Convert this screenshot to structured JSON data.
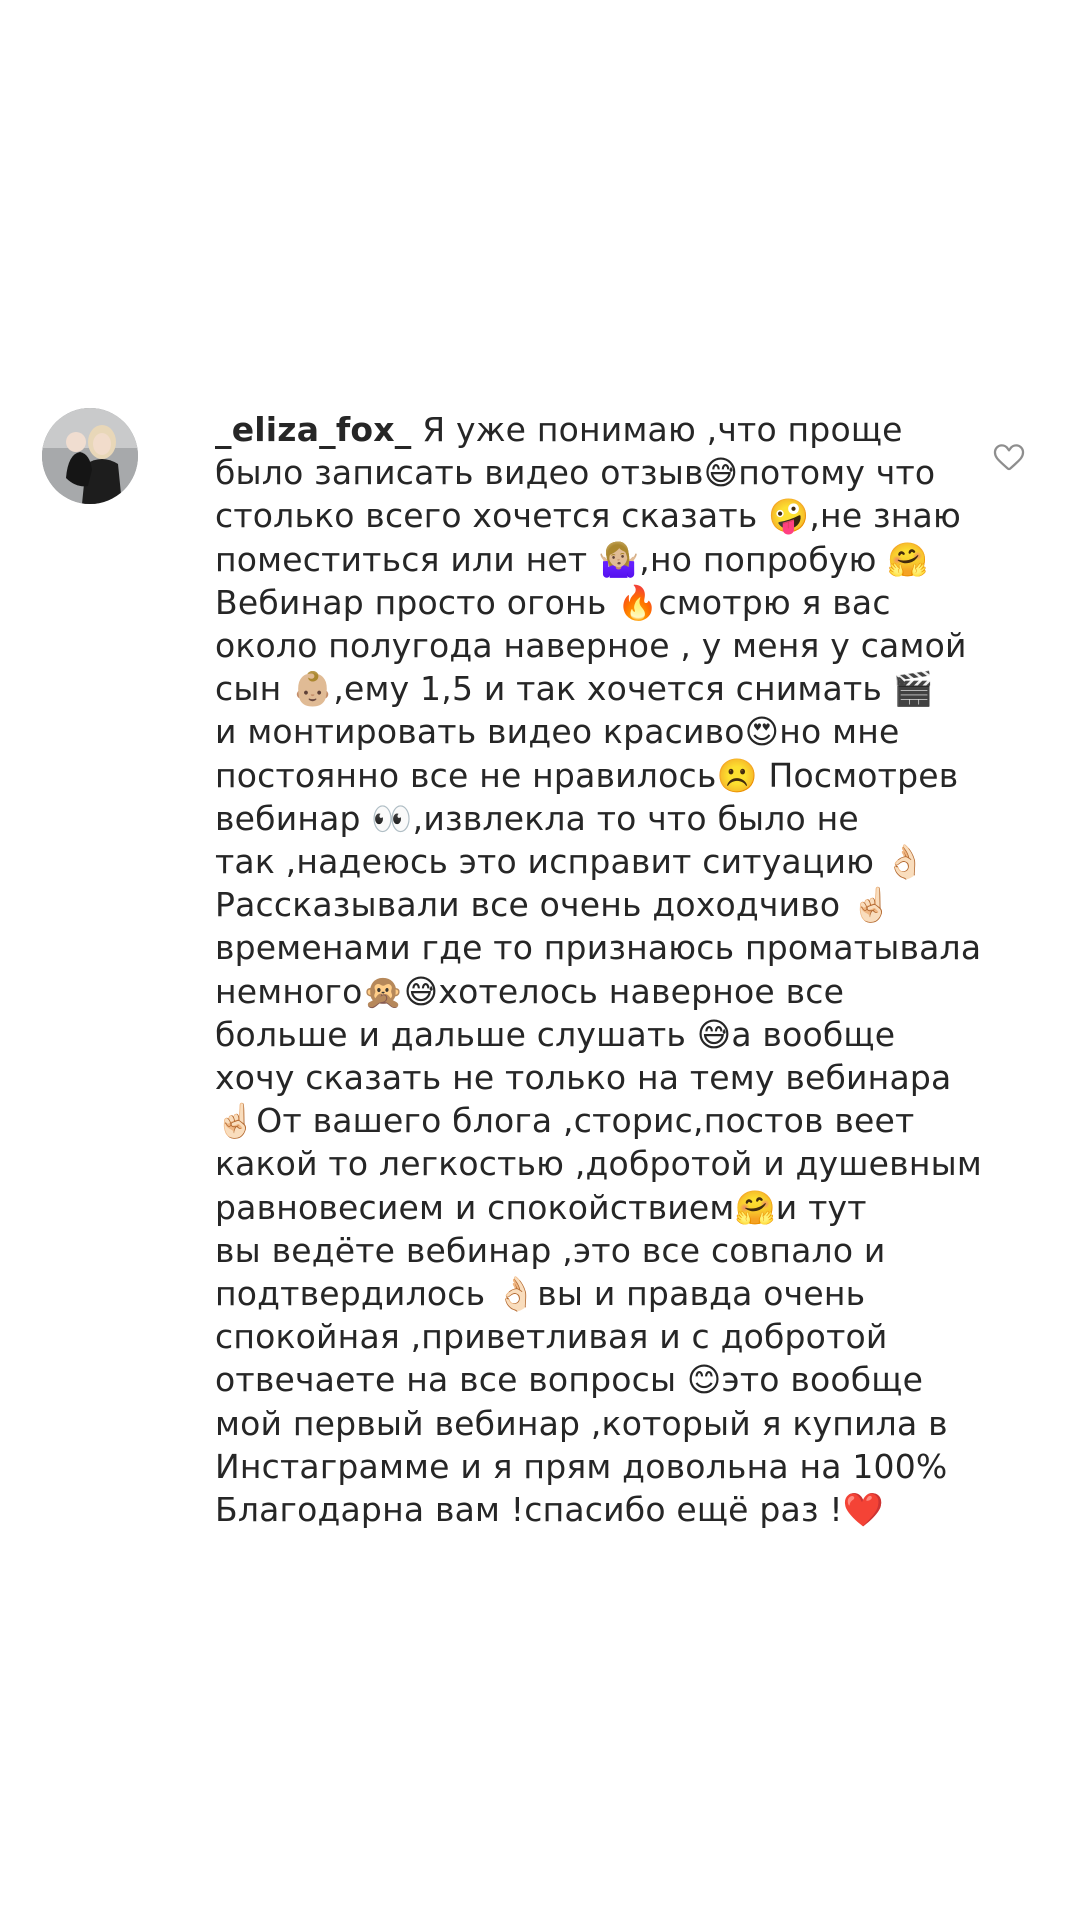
{
  "comment": {
    "username": "_eliza_fox_",
    "avatar_icon": "user-avatar-photo",
    "like_icon": "heart-outline-icon",
    "lines": [
      " Я уже понимаю ,что проще",
      "было записать видео отзыв😅потому что",
      "столько всего хочется сказать 🤪,не знаю",
      "поместиться или нет 🤷🏼‍♀️,но попробую 🤗",
      "Вебинар просто огонь 🔥смотрю я вас",
      "около полугода наверное , у меня у самой",
      "сын 👶🏼,ему 1,5 и так хочется снимать 🎬",
      "и монтировать видео красиво😍но мне",
      "постоянно все не нравилось☹️ Посмотрев",
      "вебинар 👀,извлекла то что было не",
      "так ,надеюсь это исправит ситуацию 👌🏻",
      "Рассказывали все очень доходчиво ☝🏻",
      "временами где то признаюсь проматывала",
      "немного🙊😅хотелось наверное все",
      "больше и дальше слушать 😅а вообще",
      "хочу сказать не только на тему вебинара",
      "☝🏻От вашего блога ,сторис,постов веет",
      "какой то легкостью ,добротой и душевным",
      "равновесием и спокойствием🤗и тут",
      "вы ведёте вебинар ,это все совпало и",
      "подтвердилось 👌🏻вы и правда очень",
      "спокойная ,приветливая и с добротой",
      "отвечаете на все вопросы 😊это вообще",
      "мой первый вебинар ,который я купила в",
      "Инстаграмме и я прям довольна на 100%",
      "Благодарна вам !спасибо ещё раз !❤️"
    ]
  }
}
